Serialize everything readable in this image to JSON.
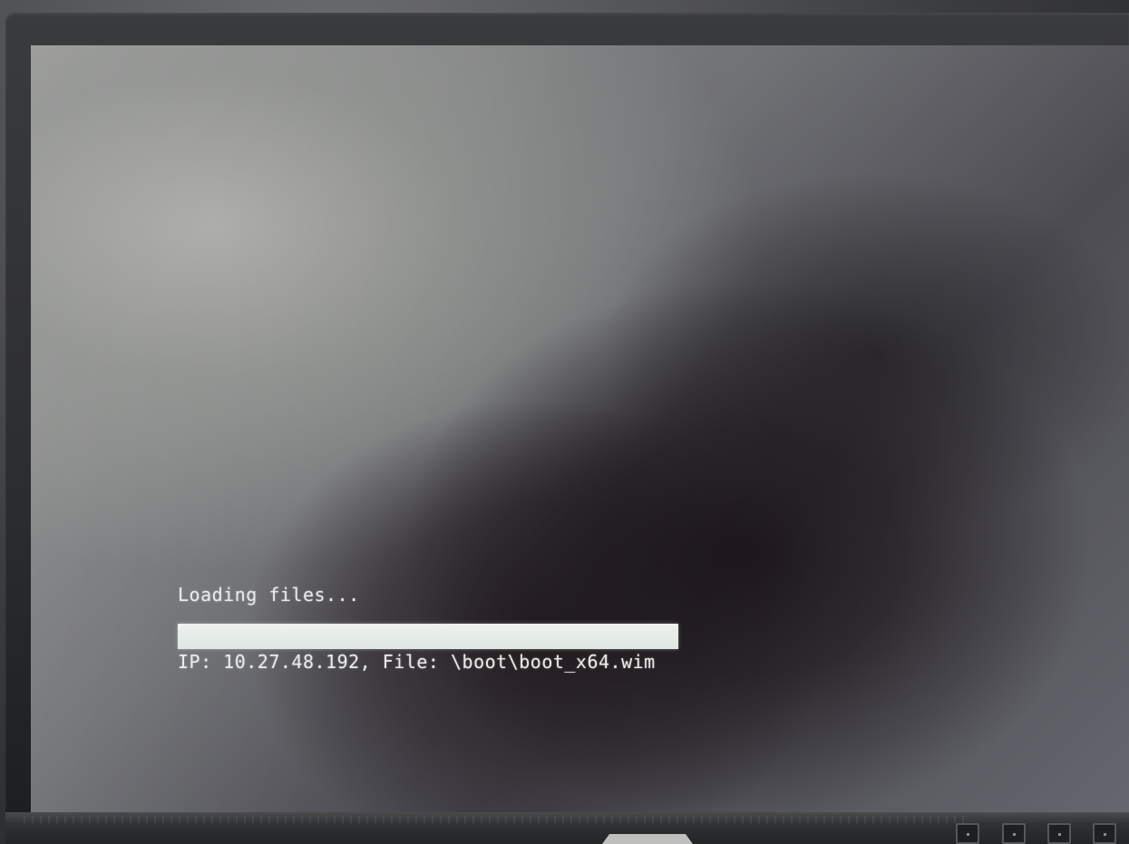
{
  "boot_screen": {
    "loading_label": "Loading files...",
    "progress": 1.0,
    "status_line": "IP: 10.27.48.192, File: \\boot\\boot_x64.wim"
  },
  "monitor": {
    "buttons": [
      "monitor-button",
      "monitor-button",
      "monitor-button",
      "monitor-button"
    ]
  },
  "colors": {
    "text": "#e9ece9",
    "progress_fill": "#eef2ef"
  }
}
